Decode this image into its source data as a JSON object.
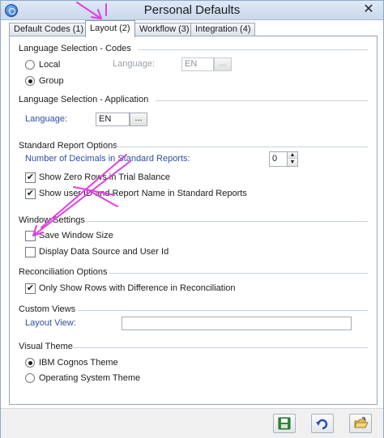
{
  "window": {
    "title": "Personal Defaults",
    "close_glyph": "✕"
  },
  "tabs": [
    {
      "label": "Default Codes (1)"
    },
    {
      "label": "Layout (2)"
    },
    {
      "label": "Workflow (3)"
    },
    {
      "label": "Integration (4)"
    }
  ],
  "active_tab": "Layout (2)",
  "lang_codes": {
    "title": "Language Selection - Codes",
    "local_label": "Local",
    "group_label": "Group",
    "selected": "Group",
    "language_label": "Language:",
    "language_value": "EN",
    "browse_label": "..."
  },
  "lang_app": {
    "title": "Language Selection - Application",
    "language_label": "Language:",
    "language_value": "EN",
    "browse_label": "..."
  },
  "report": {
    "title": "Standard Report Options",
    "decimals_label": "Number of Decimals in Standard Reports:",
    "decimals_value": "0",
    "show_zero_rows_label": "Show Zero Rows in Trial Balance",
    "show_zero_rows_checked": true,
    "show_user_id_label": "Show user ID and Report Name in Standard Reports",
    "show_user_id_checked": true
  },
  "window_settings": {
    "title": "Window Settings",
    "save_size_label": "Save Window Size",
    "save_size_checked": false,
    "display_source_label": "Display Data Source and User Id",
    "display_source_checked": false
  },
  "reconciliation": {
    "title": "Reconciliation Options",
    "only_diff_label": "Only Show Rows with Difference in Reconciliation",
    "only_diff_checked": true
  },
  "custom_views": {
    "title": "Custom Views",
    "layout_view_label": "Layout View:",
    "layout_view_value": ""
  },
  "visual_theme": {
    "title": "Visual Theme",
    "ibm_label": "IBM Cognos Theme",
    "os_label": "Operating System Theme",
    "selected": "IBM Cognos Theme"
  },
  "check_glyph": "✔",
  "colors": {
    "annotation_arrow": "#e040e0",
    "label_blue": "#2a4fa0"
  },
  "icons": [
    "app-icon",
    "close-icon",
    "save-icon",
    "undo-icon",
    "open-folder-icon"
  ]
}
